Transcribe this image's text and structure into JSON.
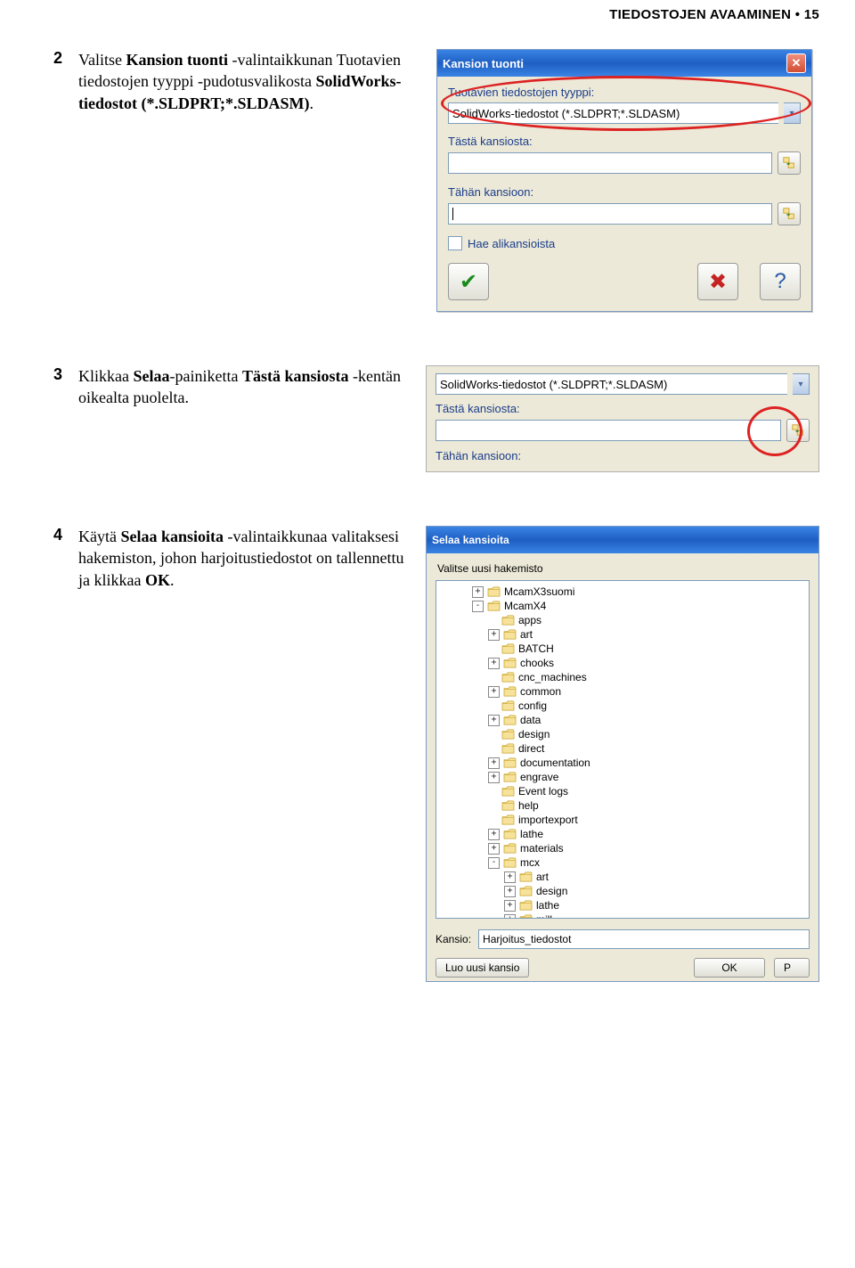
{
  "header": "TIEDOSTOJEN AVAAMINEN • 15",
  "steps": {
    "s2": {
      "num": "2",
      "t1": "Valitse ",
      "b1": "Kansion tuonti",
      "t2": " -valintaikkunan Tuotavien tiedostojen tyyppi -pudotusvalikosta ",
      "b2": "SolidWorks-tiedostot (*.SLDPRT;*.SLDASM)",
      "t3": "."
    },
    "s3": {
      "num": "3",
      "t1": "Klikkaa ",
      "b1": "Selaa",
      "t2": "-painiketta ",
      "b2": "Tästä kansiosta",
      "t3": " -kentän oikealta puolelta."
    },
    "s4": {
      "num": "4",
      "t1": "Käytä ",
      "b1": "Selaa kansioita",
      "t2": " -valintaikkunaa valitaksesi hakemiston, johon harjoitustiedostot on tallennettu ja klikkaa ",
      "b2": "OK",
      "t3": "."
    }
  },
  "dlg1": {
    "title": "Kansion tuonti",
    "lbl_type": "Tuotavien tiedostojen tyyppi:",
    "type_value": "SolidWorks-tiedostot (*.SLDPRT;*.SLDASM)",
    "lbl_from": "Tästä kansiosta:",
    "lbl_to": "Tähän kansioon:",
    "chk": "Hae alikansioista"
  },
  "dlg2": {
    "type_value": "SolidWorks-tiedostot (*.SLDPRT;*.SLDASM)",
    "lbl_from": "Tästä kansiosta:",
    "lbl_to": "Tähän kansioon:"
  },
  "dlg3": {
    "title": "Selaa kansioita",
    "subtitle": "Valitse uusi hakemisto",
    "tree": [
      {
        "indent": 2,
        "exp": "+",
        "label": "McamX3suomi"
      },
      {
        "indent": 2,
        "exp": "-",
        "label": "McamX4"
      },
      {
        "indent": 3,
        "exp": " ",
        "label": "apps"
      },
      {
        "indent": 3,
        "exp": "+",
        "label": "art"
      },
      {
        "indent": 3,
        "exp": " ",
        "label": "BATCH"
      },
      {
        "indent": 3,
        "exp": "+",
        "label": "chooks"
      },
      {
        "indent": 3,
        "exp": " ",
        "label": "cnc_machines"
      },
      {
        "indent": 3,
        "exp": "+",
        "label": "common"
      },
      {
        "indent": 3,
        "exp": " ",
        "label": "config"
      },
      {
        "indent": 3,
        "exp": "+",
        "label": "data"
      },
      {
        "indent": 3,
        "exp": " ",
        "label": "design"
      },
      {
        "indent": 3,
        "exp": " ",
        "label": "direct"
      },
      {
        "indent": 3,
        "exp": "+",
        "label": "documentation"
      },
      {
        "indent": 3,
        "exp": "+",
        "label": "engrave"
      },
      {
        "indent": 3,
        "exp": " ",
        "label": "Event logs"
      },
      {
        "indent": 3,
        "exp": " ",
        "label": "help"
      },
      {
        "indent": 3,
        "exp": " ",
        "label": "importexport"
      },
      {
        "indent": 3,
        "exp": "+",
        "label": "lathe"
      },
      {
        "indent": 3,
        "exp": "+",
        "label": "materials"
      },
      {
        "indent": 3,
        "exp": "-",
        "label": "mcx"
      },
      {
        "indent": 4,
        "exp": "+",
        "label": "art"
      },
      {
        "indent": 4,
        "exp": "+",
        "label": "design"
      },
      {
        "indent": 4,
        "exp": "+",
        "label": "lathe"
      },
      {
        "indent": 4,
        "exp": "+",
        "label": "mill"
      }
    ],
    "kansio_lbl": "Kansio:",
    "kansio_val": "Harjoitus_tiedostot",
    "btn_new": "Luo uusi kansio",
    "btn_ok": "OK",
    "btn_cancel": "P"
  }
}
